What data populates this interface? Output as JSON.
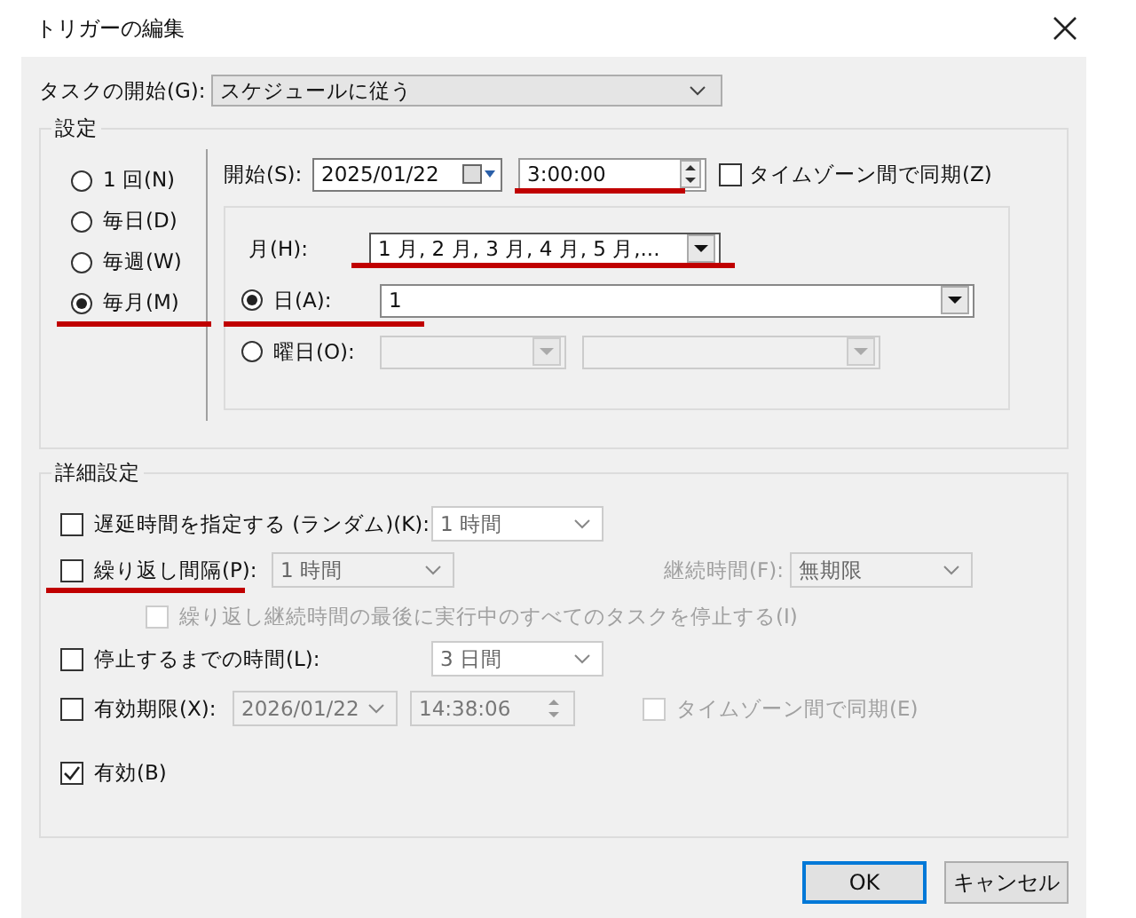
{
  "window": {
    "title": "トリガーの編集"
  },
  "task_start": {
    "label": "タスクの開始(G):",
    "value": "スケジュールに従う"
  },
  "settings": {
    "legend": "設定",
    "schedule_options": [
      {
        "label": "1 回(N)",
        "selected": false
      },
      {
        "label": "毎日(D)",
        "selected": false
      },
      {
        "label": "毎週(W)",
        "selected": false
      },
      {
        "label": "毎月(M)",
        "selected": true
      }
    ],
    "start": {
      "label": "開始(S):",
      "date": "2025/01/22",
      "time": "3:00:00",
      "sync_label": "タイムゾーン間で同期(Z)",
      "sync_checked": false
    },
    "months": {
      "label": "月(H):",
      "value": "1 月, 2 月, 3 月, 4 月, 5 月,..."
    },
    "day_options": [
      {
        "kind": "day",
        "label": "日(A):",
        "selected": true,
        "value": "1"
      },
      {
        "kind": "weekday",
        "label": "曜日(O):",
        "selected": false
      }
    ]
  },
  "advanced": {
    "legend": "詳細設定",
    "rows": [
      {
        "kind": "delay",
        "label": "遅延時間を指定する (ランダム)(K):",
        "checked": false,
        "value": "1 時間"
      },
      {
        "kind": "repeat",
        "label": "繰り返し間隔(P):",
        "checked": false,
        "value": "1 時間",
        "duration_label": "継続時間(F):",
        "duration_value": "無期限"
      },
      {
        "kind": "stop_repeat",
        "label": "繰り返し継続時間の最後に実行中のすべてのタスクを停止する(I)",
        "checked": false
      },
      {
        "kind": "stop_after",
        "label": "停止するまでの時間(L):",
        "checked": false,
        "value": "3 日間"
      },
      {
        "kind": "expire",
        "label": "有効期限(X):",
        "checked": false,
        "date": "2026/01/22",
        "time": "14:38:06",
        "sync_label": "タイムゾーン間で同期(E)",
        "sync_checked": false
      },
      {
        "kind": "enabled",
        "label": "有効(B)",
        "checked": true
      }
    ]
  },
  "buttons": [
    {
      "label": "OK",
      "default": true
    },
    {
      "label": "キャンセル",
      "default": false
    }
  ]
}
